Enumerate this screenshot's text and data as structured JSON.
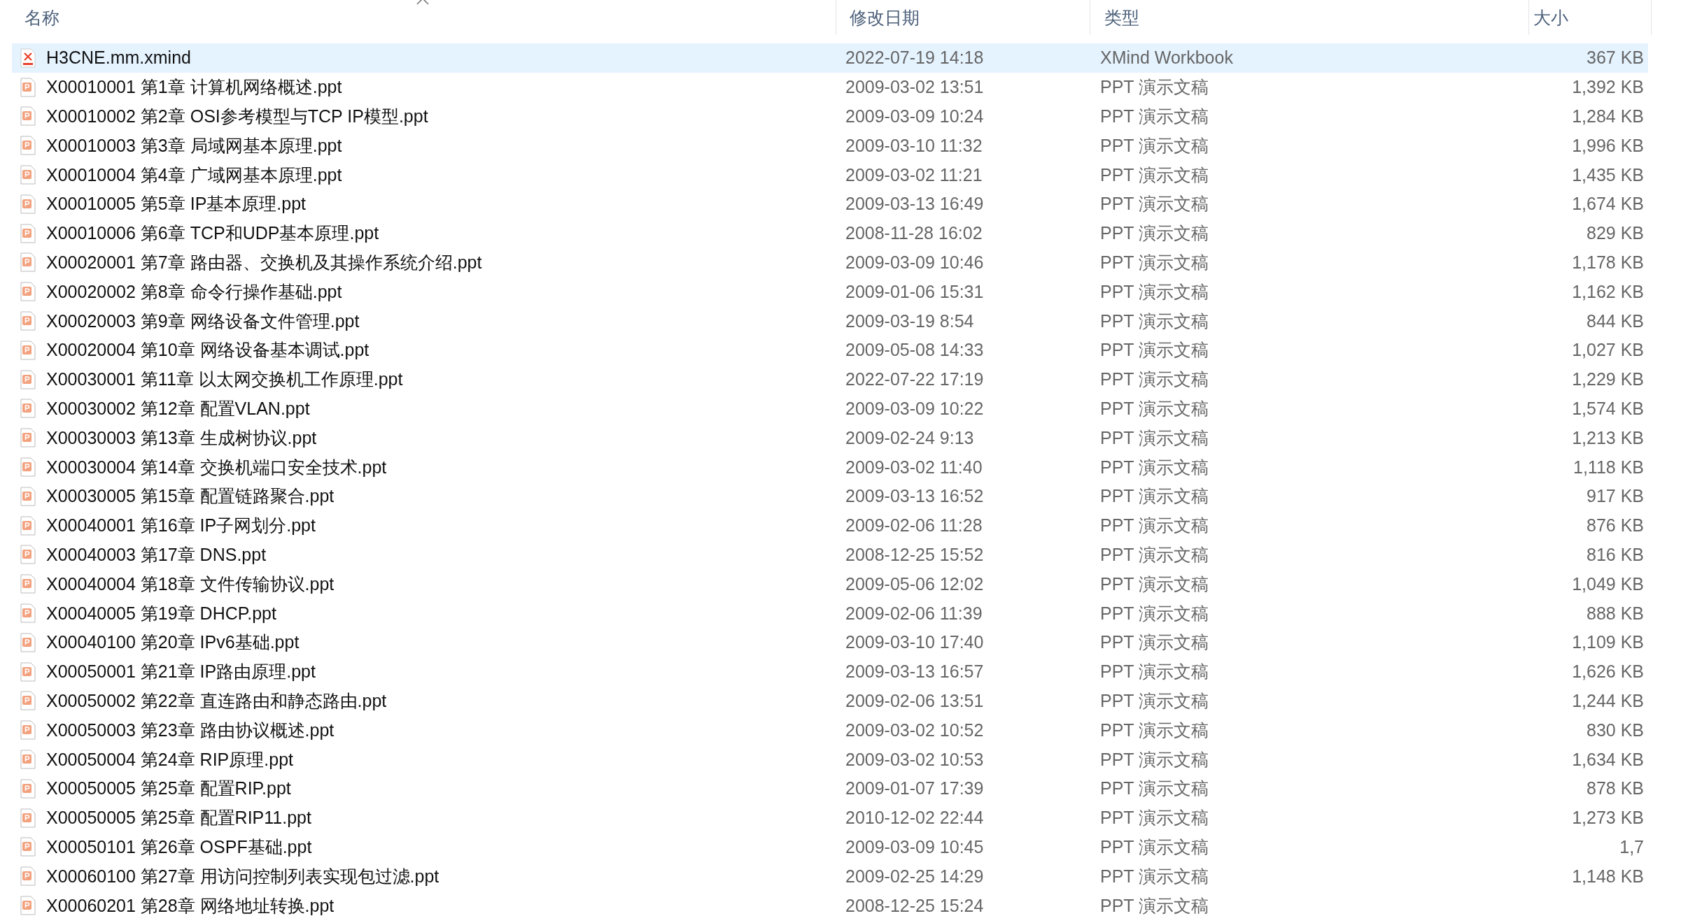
{
  "columns": [
    {
      "label": "名称",
      "kind": "name"
    },
    {
      "label": "修改日期",
      "kind": "date"
    },
    {
      "label": "类型",
      "kind": "type"
    },
    {
      "label": "大小",
      "kind": "size"
    }
  ],
  "files": [
    {
      "name": "H3CNE.mm.xmind",
      "date": "2022-07-19 14:18",
      "type": "XMind Workbook",
      "size": "367 KB",
      "kind": "xmind",
      "selected": true
    },
    {
      "name": "X00010001 第1章 计算机网络概述.ppt",
      "date": "2009-03-02 13:51",
      "type": "PPT 演示文稿",
      "size": "1,392 KB",
      "kind": "ppt",
      "selected": false
    },
    {
      "name": "X00010002 第2章 OSI参考模型与TCP IP模型.ppt",
      "date": "2009-03-09 10:24",
      "type": "PPT 演示文稿",
      "size": "1,284 KB",
      "kind": "ppt",
      "selected": false
    },
    {
      "name": "X00010003 第3章 局域网基本原理.ppt",
      "date": "2009-03-10 11:32",
      "type": "PPT 演示文稿",
      "size": "1,996 KB",
      "kind": "ppt",
      "selected": false
    },
    {
      "name": "X00010004 第4章 广域网基本原理.ppt",
      "date": "2009-03-02 11:21",
      "type": "PPT 演示文稿",
      "size": "1,435 KB",
      "kind": "ppt",
      "selected": false
    },
    {
      "name": "X00010005 第5章 IP基本原理.ppt",
      "date": "2009-03-13 16:49",
      "type": "PPT 演示文稿",
      "size": "1,674 KB",
      "kind": "ppt",
      "selected": false
    },
    {
      "name": "X00010006 第6章 TCP和UDP基本原理.ppt",
      "date": "2008-11-28 16:02",
      "type": "PPT 演示文稿",
      "size": "829 KB",
      "kind": "ppt",
      "selected": false
    },
    {
      "name": "X00020001 第7章 路由器、交换机及其操作系统介绍.ppt",
      "date": "2009-03-09 10:46",
      "type": "PPT 演示文稿",
      "size": "1,178 KB",
      "kind": "ppt",
      "selected": false
    },
    {
      "name": "X00020002 第8章 命令行操作基础.ppt",
      "date": "2009-01-06 15:31",
      "type": "PPT 演示文稿",
      "size": "1,162 KB",
      "kind": "ppt",
      "selected": false
    },
    {
      "name": "X00020003 第9章 网络设备文件管理.ppt",
      "date": "2009-03-19 8:54",
      "type": "PPT 演示文稿",
      "size": "844 KB",
      "kind": "ppt",
      "selected": false
    },
    {
      "name": "X00020004 第10章 网络设备基本调试.ppt",
      "date": "2009-05-08 14:33",
      "type": "PPT 演示文稿",
      "size": "1,027 KB",
      "kind": "ppt",
      "selected": false
    },
    {
      "name": "X00030001 第11章 以太网交换机工作原理.ppt",
      "date": "2022-07-22 17:19",
      "type": "PPT 演示文稿",
      "size": "1,229 KB",
      "kind": "ppt",
      "selected": false
    },
    {
      "name": "X00030002 第12章 配置VLAN.ppt",
      "date": "2009-03-09 10:22",
      "type": "PPT 演示文稿",
      "size": "1,574 KB",
      "kind": "ppt",
      "selected": false
    },
    {
      "name": "X00030003 第13章 生成树协议.ppt",
      "date": "2009-02-24 9:13",
      "type": "PPT 演示文稿",
      "size": "1,213 KB",
      "kind": "ppt",
      "selected": false
    },
    {
      "name": "X00030004 第14章 交换机端口安全技术.ppt",
      "date": "2009-03-02 11:40",
      "type": "PPT 演示文稿",
      "size": "1,118 KB",
      "kind": "ppt",
      "selected": false
    },
    {
      "name": "X00030005 第15章 配置链路聚合.ppt",
      "date": "2009-03-13 16:52",
      "type": "PPT 演示文稿",
      "size": "917 KB",
      "kind": "ppt",
      "selected": false
    },
    {
      "name": "X00040001 第16章 IP子网划分.ppt",
      "date": "2009-02-06 11:28",
      "type": "PPT 演示文稿",
      "size": "876 KB",
      "kind": "ppt",
      "selected": false
    },
    {
      "name": "X00040003 第17章 DNS.ppt",
      "date": "2008-12-25 15:52",
      "type": "PPT 演示文稿",
      "size": "816 KB",
      "kind": "ppt",
      "selected": false
    },
    {
      "name": "X00040004 第18章 文件传输协议.ppt",
      "date": "2009-05-06 12:02",
      "type": "PPT 演示文稿",
      "size": "1,049 KB",
      "kind": "ppt",
      "selected": false
    },
    {
      "name": "X00040005 第19章 DHCP.ppt",
      "date": "2009-02-06 11:39",
      "type": "PPT 演示文稿",
      "size": "888 KB",
      "kind": "ppt",
      "selected": false
    },
    {
      "name": "X00040100 第20章 IPv6基础.ppt",
      "date": "2009-03-10 17:40",
      "type": "PPT 演示文稿",
      "size": "1,109 KB",
      "kind": "ppt",
      "selected": false
    },
    {
      "name": "X00050001 第21章 IP路由原理.ppt",
      "date": "2009-03-13 16:57",
      "type": "PPT 演示文稿",
      "size": "1,626 KB",
      "kind": "ppt",
      "selected": false
    },
    {
      "name": "X00050002 第22章 直连路由和静态路由.ppt",
      "date": "2009-02-06 13:51",
      "type": "PPT 演示文稿",
      "size": "1,244 KB",
      "kind": "ppt",
      "selected": false
    },
    {
      "name": "X00050003 第23章 路由协议概述.ppt",
      "date": "2009-03-02 10:52",
      "type": "PPT 演示文稿",
      "size": "830 KB",
      "kind": "ppt",
      "selected": false
    },
    {
      "name": "X00050004 第24章 RIP原理.ppt",
      "date": "2009-03-02 10:53",
      "type": "PPT 演示文稿",
      "size": "1,634 KB",
      "kind": "ppt",
      "selected": false
    },
    {
      "name": "X00050005 第25章 配置RIP.ppt",
      "date": "2009-01-07 17:39",
      "type": "PPT 演示文稿",
      "size": "878 KB",
      "kind": "ppt",
      "selected": false
    },
    {
      "name": "X00050005 第25章 配置RIP11.ppt",
      "date": "2010-12-02 22:44",
      "type": "PPT 演示文稿",
      "size": "1,273 KB",
      "kind": "ppt",
      "selected": false
    },
    {
      "name": "X00050101 第26章 OSPF基础.ppt",
      "date": "2009-03-09 10:45",
      "type": "PPT 演示文稿",
      "size": "1,7",
      "kind": "ppt",
      "selected": false
    },
    {
      "name": "X00060100 第27章 用访问控制列表实现包过滤.ppt",
      "date": "2009-02-25 14:29",
      "type": "PPT 演示文稿",
      "size": "1,148 KB",
      "kind": "ppt",
      "selected": false
    },
    {
      "name": "X00060201 第28章 网络地址转换.ppt",
      "date": "2008-12-25 15:24",
      "type": "PPT 演示文稿",
      "kind": "ppt",
      "selected": false
    }
  ]
}
